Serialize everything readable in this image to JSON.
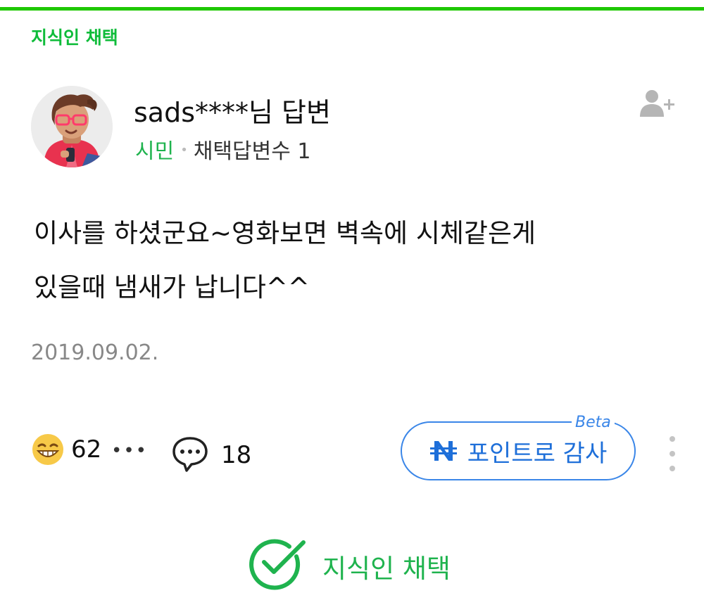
{
  "header": {
    "chosen_label": "지식인 채택"
  },
  "author": {
    "name": "sads****님 답변",
    "grade": "시민",
    "adopted_count": "채택답변수 1"
  },
  "answer": {
    "body": "이사를 하셨군요~영화보면 벽속에 시체같은게\n있을때 냄새가 납니다^^",
    "date": "2019.09.02."
  },
  "actions": {
    "reaction_count": "62",
    "comment_count": "18",
    "point_button_label": "포인트로 감사",
    "beta_label": "Beta"
  },
  "footer": {
    "chosen_label": "지식인 채택"
  },
  "colors": {
    "accent_green": "#1fb34e",
    "top_rule": "#1ec800",
    "point_blue": "#1e6fd9"
  },
  "icons": [
    "avatar",
    "add-friend-icon",
    "grin-emoji-icon",
    "more-icon",
    "comment-icon",
    "npay-icon",
    "kebab-icon",
    "check-circle-icon"
  ]
}
